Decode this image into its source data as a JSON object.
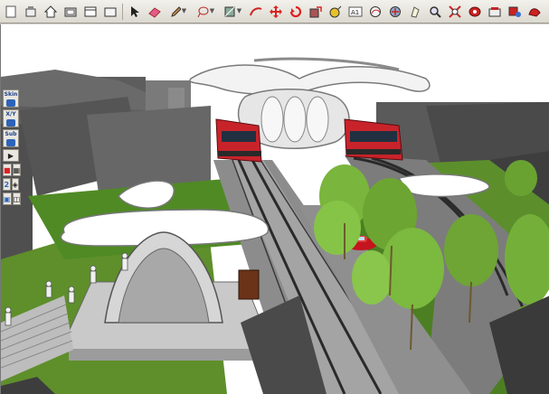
{
  "toolbar": {
    "tools": [
      {
        "name": "new-icon"
      },
      {
        "name": "home-view-icon"
      },
      {
        "name": "house-icon"
      },
      {
        "name": "component-icon"
      },
      {
        "name": "window-icon"
      },
      {
        "name": "box-icon"
      },
      {
        "name": "select-arrow-icon"
      },
      {
        "name": "eraser-icon"
      },
      {
        "name": "pencil-icon"
      },
      {
        "name": "lasso-icon"
      },
      {
        "name": "paint-bucket-icon"
      },
      {
        "name": "follow-me-icon"
      },
      {
        "name": "move-icon"
      },
      {
        "name": "rotate-icon"
      },
      {
        "name": "scale-icon"
      },
      {
        "name": "tape-measure-icon"
      },
      {
        "name": "text-tool-icon"
      },
      {
        "name": "orbit-icon"
      },
      {
        "name": "pan-icon"
      },
      {
        "name": "walk-icon"
      },
      {
        "name": "zoom-icon"
      },
      {
        "name": "zoom-extents-icon"
      },
      {
        "name": "section-icon"
      },
      {
        "name": "camera-icon"
      },
      {
        "name": "paint-icon"
      },
      {
        "name": "materials-icon"
      },
      {
        "name": "settings-icon"
      }
    ],
    "text_tool_label": "A1"
  },
  "sidepanel": {
    "skin_label": "Skin",
    "xy_label": "X/Y",
    "sub_label": "Sub"
  },
  "colors": {
    "sky": "#ffffff",
    "grass": "#5e8f2b",
    "building": "#5a5a5a",
    "tram": "#c8232b",
    "tree": "#79b83a"
  }
}
